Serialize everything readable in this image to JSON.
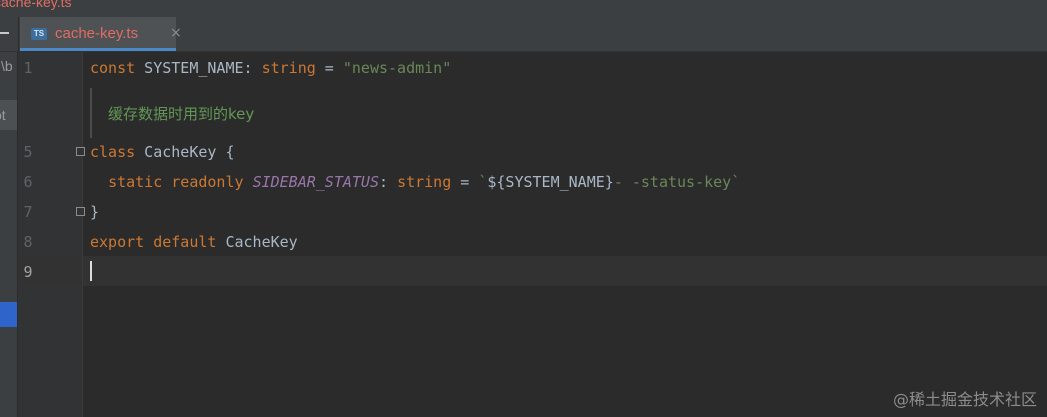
{
  "window": {
    "title": "cache-key.ts"
  },
  "tabs": [
    {
      "label": "cache-key.ts",
      "icon": "typescript-file-icon",
      "icon_text": "TS",
      "close_glyph": "×",
      "active": true
    }
  ],
  "left_panel": {
    "path_fragment": "\\b",
    "label_fragment": "ot"
  },
  "editor": {
    "line_numbers": [
      "1",
      "5",
      "6",
      "7",
      "8",
      "9"
    ],
    "current_line": "9",
    "code": {
      "l1": {
        "kw_const": "const",
        "name": " SYSTEM_NAME",
        "colon": ": ",
        "type": "string",
        "eq": " = ",
        "value": "\"news-admin\""
      },
      "doc_comment": "缓存数据时用到的key",
      "l5": {
        "kw_class": "class",
        "name": " CacheKey {"
      },
      "l6": {
        "indent": "  ",
        "kw_static": "static",
        "sp1": " ",
        "kw_readonly": "readonly",
        "sp2": " ",
        "field": "SIDEBAR_STATUS",
        "colon": ": ",
        "type": "string",
        "eq": " = ",
        "tpl_start": "`",
        "interp": "${SYSTEM_NAME}",
        "tpl_rest": "- -status-key`"
      },
      "l7": {
        "brace": "}"
      },
      "l8": {
        "kw_export": "export",
        "sp1": " ",
        "kw_default": "default",
        "name": " CacheKey"
      }
    }
  },
  "watermark": "@稀土掘金技术社区",
  "colors": {
    "background": "#2b2b2b",
    "gutter": "#313335",
    "keyword": "#cc7832",
    "string": "#6a8759",
    "plain": "#a9b7c6",
    "field": "#9876aa",
    "doc_comment": "#629755",
    "tab_label": "#e06c63",
    "tab_underline": "#4a88c7"
  }
}
